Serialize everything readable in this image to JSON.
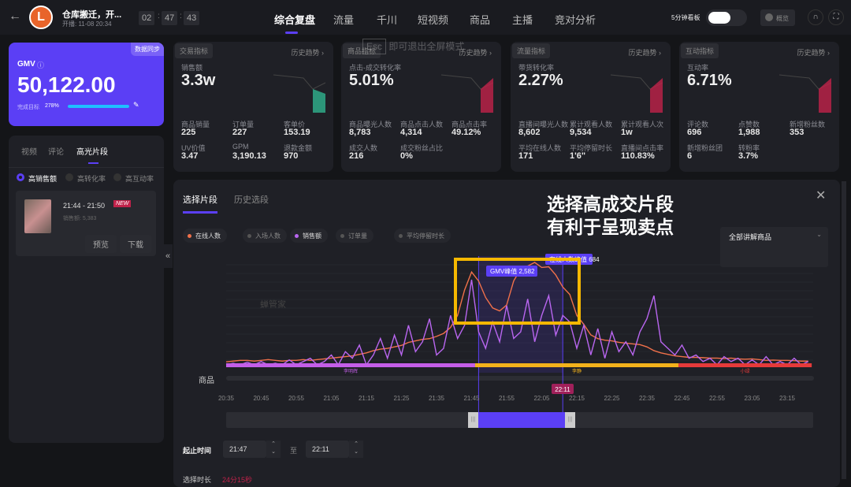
{
  "header": {
    "title": "仓库搬迁，开...",
    "start": "开播: 11-08 20:34",
    "timer": [
      "02",
      "47",
      "43"
    ],
    "tabs": [
      "综合复盘",
      "流量",
      "千川",
      "短视频",
      "商品",
      "主播",
      "竞对分析"
    ],
    "toggle_label": "5分钟看板",
    "overview_label": "概览"
  },
  "esc_hint": {
    "key": "Esc",
    "text": "即可退出全屏模式"
  },
  "gmv_card": {
    "sync": "数据同步",
    "label": "GMV",
    "value": "50,122.00",
    "target_label": "完成目标",
    "target_pct": "278%",
    "target_fraction": 1.0
  },
  "left_panel": {
    "tabs": [
      "视频",
      "评论",
      "高光片段"
    ],
    "filters": [
      "高销售额",
      "高转化率",
      "高互动率"
    ],
    "clip": {
      "time": "21:44 - 21:50",
      "badge": "NEW",
      "sales": "销售额: 5,383",
      "preview": "预览",
      "download": "下载"
    }
  },
  "metric_cards": [
    {
      "tag": "交易指标",
      "history": "历史趋势",
      "main_label": "销售额",
      "main_value": "3.3w",
      "color": "#2fb38f",
      "stats": [
        [
          "商品销量",
          "225"
        ],
        [
          "订单量",
          "227"
        ],
        [
          "客单价",
          "153.19"
        ],
        [
          "UV价值",
          "3.47"
        ],
        [
          "GPM",
          "3,190.13"
        ],
        [
          "退款金额",
          "970"
        ]
      ]
    },
    {
      "tag": "商品指标",
      "history": "历史趋势",
      "main_label": "点击-成交转化率",
      "main_value": "5.01%",
      "color": "#c0224a",
      "stats": [
        [
          "商品曝光人数",
          "8,783"
        ],
        [
          "商品点击人数",
          "4,314"
        ],
        [
          "商品点击率",
          "49.12%"
        ],
        [
          "成交人数",
          "216"
        ],
        [
          "成交粉丝占比",
          "0%"
        ]
      ]
    },
    {
      "tag": "流量指标",
      "history": "历史趋势",
      "main_label": "带货转化率",
      "main_value": "2.27%",
      "color": "#c0224a",
      "stats": [
        [
          "直播间曝光人数",
          "8,602"
        ],
        [
          "累计观看人数",
          "9,534"
        ],
        [
          "累计观看人次",
          "1w"
        ],
        [
          "平均在线人数",
          "171"
        ],
        [
          "平均停留时长",
          "1'6\""
        ],
        [
          "直播间点击率",
          "110.83%"
        ]
      ]
    },
    {
      "tag": "互动指标",
      "history": "历史趋势",
      "main_label": "互动率",
      "main_value": "6.71%",
      "color": "#c0224a",
      "stats": [
        [
          "评论数",
          "696"
        ],
        [
          "点赞数",
          "1,988"
        ],
        [
          "新增粉丝数",
          "353"
        ],
        [
          "新增粉丝团",
          "6"
        ],
        [
          "转粉率",
          "3.7%"
        ]
      ]
    }
  ],
  "panel": {
    "tabs": [
      "选择片段",
      "历史选段"
    ],
    "dropdown": "全部讲解商品",
    "overlay_line1": "选择高成交片段",
    "overlay_line2": "有利于呈现卖点",
    "legend": [
      {
        "label": "在线人数",
        "color": "#f0704a",
        "active": true
      },
      {
        "label": "入场人数",
        "color": "#555",
        "active": false
      },
      {
        "label": "销售额",
        "color": "#b966f0",
        "active": true
      },
      {
        "label": "订单量",
        "color": "#555",
        "active": false
      },
      {
        "label": "平均停留时长",
        "color": "#555",
        "active": false
      }
    ],
    "watermark": "蝉管家",
    "product_row_label": "商品",
    "range_label": "起止时间",
    "range_to": "至",
    "start": "21:47",
    "end": "22:11",
    "duration_label": "选择时长",
    "duration": "24分15秒"
  },
  "chart_data": {
    "type": "line",
    "x_start": "20:35",
    "x_step_min": 2,
    "x_ticks": [
      "20:35",
      "20:45",
      "20:55",
      "21:05",
      "21:15",
      "21:25",
      "21:35",
      "21:45",
      "21:55",
      "22:05",
      "22:15",
      "22:25",
      "22:35",
      "22:45",
      "22:55",
      "23:05",
      "23:15"
    ],
    "series": [
      {
        "name": "在线人数",
        "color": "#f0704a",
        "max": 684,
        "peak_label": "在线人数峰值 684",
        "values": [
          20,
          25,
          30,
          30,
          25,
          30,
          35,
          30,
          25,
          30,
          30,
          35,
          30,
          35,
          40,
          45,
          50,
          55,
          60,
          70,
          80,
          95,
          105,
          110,
          120,
          130,
          150,
          160,
          170,
          175,
          190,
          210,
          250,
          330,
          500,
          620,
          560,
          450,
          380,
          360,
          400,
          560,
          640,
          660,
          684,
          650,
          655,
          600,
          520,
          470,
          330,
          270,
          200,
          175,
          165,
          160,
          150,
          145,
          140,
          135,
          120,
          95,
          80,
          70,
          60,
          55,
          50,
          50,
          48,
          45,
          45,
          42,
          45,
          40,
          38,
          40,
          35,
          30,
          32,
          30,
          30,
          28,
          25,
          25
        ]
      },
      {
        "name": "销售额",
        "color": "#b966f0",
        "max": 2582,
        "peak_label": "GMV峰值 2,582",
        "values": [
          0,
          50,
          0,
          80,
          0,
          100,
          0,
          50,
          0,
          150,
          0,
          100,
          200,
          0,
          100,
          300,
          0,
          400,
          200,
          600,
          0,
          300,
          800,
          200,
          900,
          300,
          1200,
          400,
          700,
          1400,
          300,
          500,
          1500,
          800,
          1200,
          2582,
          1000,
          500,
          1300,
          700,
          1800,
          800,
          1000,
          2000,
          700,
          1500,
          2100,
          900,
          1500,
          1300,
          500,
          1200,
          300,
          1100,
          200,
          1000,
          400,
          700,
          300,
          1000,
          1400,
          2100,
          700,
          500,
          300,
          600,
          200,
          300,
          100,
          200,
          0,
          250,
          100,
          200,
          0,
          150,
          0,
          250,
          0,
          100,
          0,
          200,
          0,
          100
        ]
      }
    ],
    "products": [
      {
        "name": "李明辉",
        "from": "20:35",
        "to": "21:46",
        "color": "#c45ee8"
      },
      {
        "name": "李静",
        "from": "21:46",
        "to": "22:44",
        "color": "#f3b21b"
      },
      {
        "name": "小绿",
        "from": "22:44",
        "to": "23:22",
        "color": "#e53a3a"
      }
    ],
    "selection": {
      "from": "21:47",
      "to": "22:11",
      "cursor_label": "22:11"
    }
  }
}
